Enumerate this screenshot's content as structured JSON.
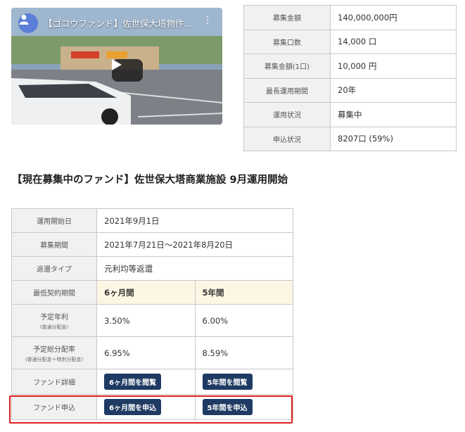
{
  "video": {
    "title": "【ゴコウファンド】佐世保大塔物件紹...",
    "avatar_icon": "user-avatar-icon",
    "more_icon": "more-vert-icon",
    "play_icon": "play-icon"
  },
  "top_table": {
    "rows": [
      {
        "label": "募集金額",
        "value": "140,000,000円"
      },
      {
        "label": "募集口数",
        "value": "14,000 口"
      },
      {
        "label": "募集金額(1口)",
        "value": "10,000 円"
      },
      {
        "label": "最長運用期間",
        "value": "20年"
      },
      {
        "label": "運用状況",
        "value": "募集中"
      },
      {
        "label": "申込状況",
        "value": "8207口 (59%)"
      }
    ]
  },
  "heading": "【現在募集中のファンド】佐世保大塔商業施設 9月運用開始",
  "fund_table": {
    "start_label": "運用開始日",
    "start_value": "2021年9月1日",
    "period_label": "募集期間",
    "period_value": "2021年7月21日～2021年8月20日",
    "repay_label": "返還タイプ",
    "repay_value": "元利均等返還",
    "min_term_label": "最低契約期間",
    "term_6m": "6ヶ月間",
    "term_5y": "5年間",
    "rate_label": "予定年利",
    "rate_sub": "(普通分配金)",
    "rate_6m": "3.50%",
    "rate_5y": "6.00%",
    "total_label": "予定総分配率",
    "total_sub": "(普通分配金＋特別分配金)",
    "total_6m": "6.95%",
    "total_5y": "8.59%",
    "detail_label": "ファンド詳細",
    "detail_6m_btn": "6ヶ月間を閲覧",
    "detail_5y_btn": "5年間を閲覧",
    "apply_label": "ファンド申込",
    "apply_6m_btn": "6ヶ月間を申込",
    "apply_5y_btn": "5年間を申込"
  },
  "colors": {
    "button_bg": "#1f3b63",
    "highlight": "#e02020",
    "term_header_bg": "#fdf6e4"
  }
}
